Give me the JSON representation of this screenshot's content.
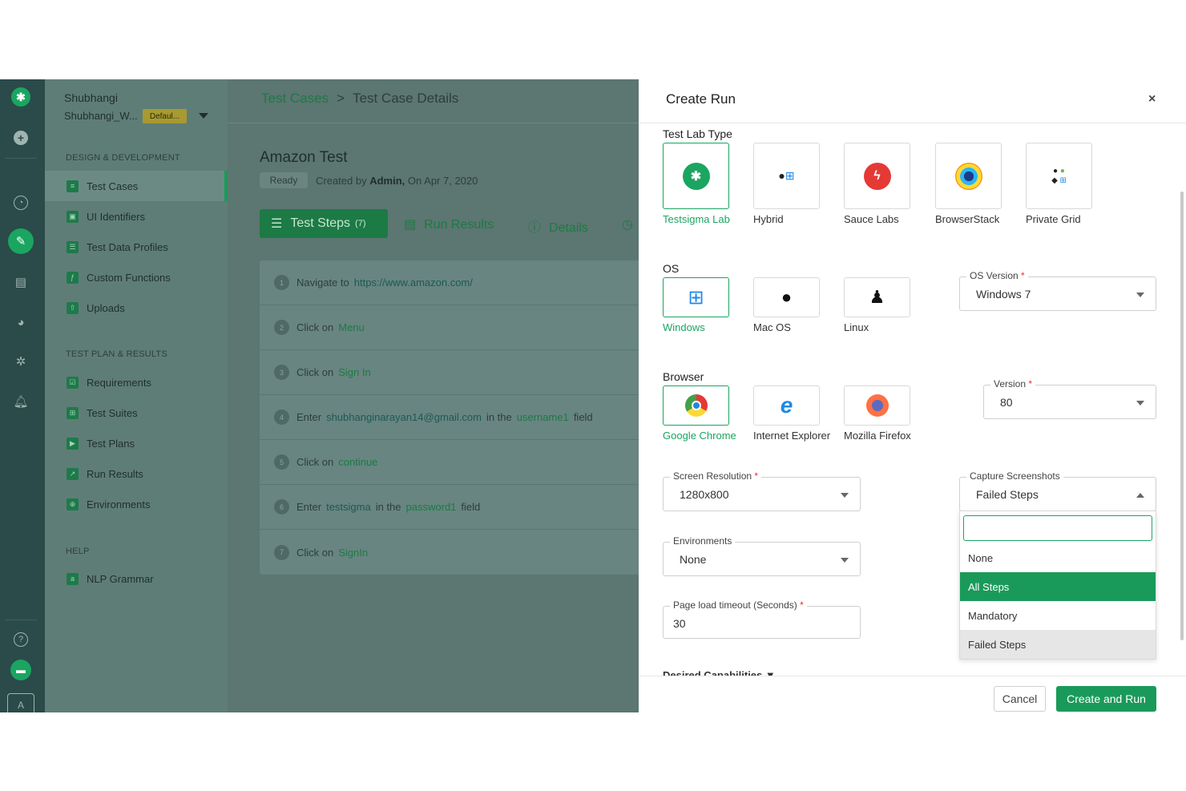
{
  "workspace": {
    "name": "Shubhangi",
    "sub": "Shubhangi_W...",
    "badge": "Defaul..."
  },
  "nav": {
    "section1": "DESIGN & DEVELOPMENT",
    "items1": [
      "Test Cases",
      "UI Identifiers",
      "Test Data Profiles",
      "Custom Functions",
      "Uploads"
    ],
    "section2": "TEST PLAN & RESULTS",
    "items2": [
      "Requirements",
      "Test Suites",
      "Test Plans",
      "Run Results",
      "Environments"
    ],
    "section3": "HELP",
    "items3": [
      "NLP Grammar"
    ]
  },
  "rail": {
    "avatar": "A",
    "icons": [
      "testsigma-logo-icon",
      "add-icon",
      "dashboard-icon",
      "edit-icon",
      "briefcase-icon",
      "pie-chart-icon",
      "settings-bug-icon",
      "bell-icon",
      "help-icon",
      "chat-icon"
    ]
  },
  "breadcrumb": {
    "root": "Test Cases",
    "sep": ">",
    "current": "Test Case Details"
  },
  "testcase": {
    "title": "Amazon Test",
    "status": "Ready",
    "created_prefix": "Created by",
    "created_by": "Admin,",
    "created_on": "On Apr 7, 2020"
  },
  "tabs": {
    "steps": "Test Steps",
    "steps_count": "(7)",
    "results": "Run Results",
    "details": "Details"
  },
  "steps": [
    {
      "num": "1",
      "action": "Navigate to",
      "target": "https://www.amazon.com/"
    },
    {
      "num": "2",
      "action": "Click on",
      "target": "Menu"
    },
    {
      "num": "3",
      "action": "Click on",
      "target": "Sign In"
    },
    {
      "num": "4",
      "action": "Enter",
      "value": "shubhanginarayan14@gmail.com",
      "mid": "in the",
      "target": "username1",
      "suffix": "field"
    },
    {
      "num": "5",
      "action": "Click on",
      "target": "continue"
    },
    {
      "num": "6",
      "action": "Enter",
      "value": "testsigma",
      "mid": "in the",
      "target": "password1",
      "suffix": "field"
    },
    {
      "num": "7",
      "action": "Click on",
      "target": "SignIn"
    }
  ],
  "modal": {
    "title": "Create Run",
    "close": "×",
    "lab_type_label": "Test Lab Type",
    "lab_types": [
      "Testsigma Lab",
      "Hybrid",
      "Sauce Labs",
      "BrowserStack",
      "Private Grid"
    ],
    "os_label": "OS",
    "os_options": [
      "Windows",
      "Mac OS",
      "Linux"
    ],
    "os_version": {
      "label": "OS Version",
      "value": "Windows 7"
    },
    "browser_label": "Browser",
    "browsers": [
      "Google Chrome",
      "Internet Explorer",
      "Mozilla Firefox"
    ],
    "version": {
      "label": "Version",
      "value": "80"
    },
    "screen_res": {
      "label": "Screen Resolution",
      "value": "1280x800"
    },
    "capture": {
      "label": "Capture Screenshots",
      "value": "Failed Steps"
    },
    "environments": {
      "label": "Environments",
      "value": "None"
    },
    "page_load": {
      "label": "Page load timeout (Seconds)",
      "value": "30"
    },
    "required_mark": "*",
    "dropdown_options": [
      "None",
      "All Steps",
      "Mandatory",
      "Failed Steps"
    ],
    "desired": "Desired Capabilities",
    "cancel": "Cancel",
    "create": "Create and Run"
  },
  "colors": {
    "accent": "#1aa561",
    "rail": "#2b4a4a",
    "required": "#e0323a"
  }
}
